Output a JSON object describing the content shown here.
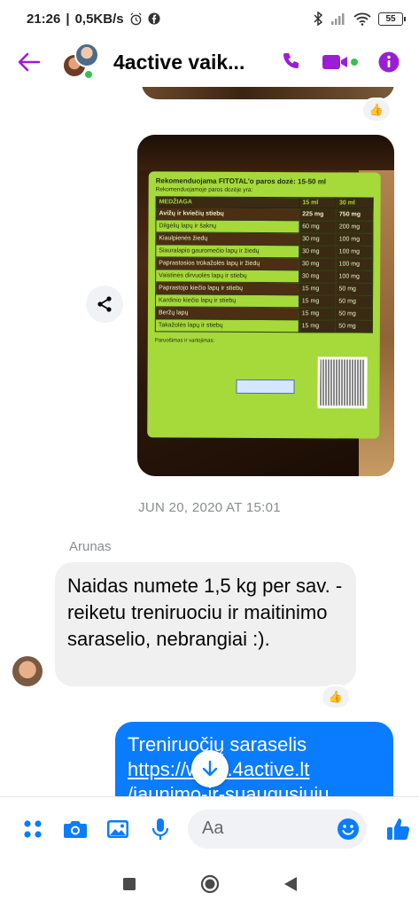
{
  "status_bar": {
    "time": "21:26",
    "speed": "0,5KB/s",
    "battery": "55",
    "icons": [
      "alarm-icon",
      "facebook-icon",
      "bluetooth-icon",
      "signal-icon",
      "wifi-icon",
      "battery-icon"
    ]
  },
  "header": {
    "title": "4active vaik...",
    "back_icon": "arrow-left-icon",
    "actions": [
      "phone-icon",
      "video-icon",
      "info-icon"
    ],
    "accent_color": "#9b1ed6"
  },
  "photo_label": {
    "title": "Rekomenduojama FITOTAL'o paros dozė: 15-50 ml",
    "subtitle": "Rekomenduojamoje paros dozėje yra:",
    "columns": [
      "MEDŽIAGA",
      "15 ml",
      "30 ml"
    ],
    "rows": [
      [
        "Avižų ir kviečių stiebų",
        "225 mg",
        "750 mg"
      ],
      [
        "Dilgėlių lapų ir šaknų",
        "60 mg",
        "200 mg"
      ],
      [
        "Kiaulpienės žiedų",
        "30 mg",
        "100 mg"
      ],
      [
        "Siauralapio gauromečio lapų ir žiedų",
        "30 mg",
        "100 mg"
      ],
      [
        "Paprastosios trūkažolės lapų ir žiedų",
        "30 mg",
        "100 mg"
      ],
      [
        "Vaistinės dirvuolės lapų ir stiebų",
        "30 mg",
        "100 mg"
      ],
      [
        "Paprastojo kiečio lapų ir stiebų",
        "15 mg",
        "50 mg"
      ],
      [
        "Kardinio kiečio lapų ir stiebų",
        "15 mg",
        "50 mg"
      ],
      [
        "Beržų lapų",
        "15 mg",
        "50 mg"
      ],
      [
        "Takažolės lapų ir stiebų",
        "15 mg",
        "50 mg"
      ]
    ],
    "usage_title": "Paruošimas ir vartojimas:"
  },
  "conversation": {
    "timestamp": "JUN 20, 2020 AT 15:01",
    "sender": "Arunas",
    "incoming_text": "Naidas numete 1,5 kg per sav. - reiketu treniruociu ir maitinimo saraselio, nebrangiai :).",
    "outgoing_line1": "Treniruočių saraselis",
    "outgoing_link": "https://www.4active.lt",
    "outgoing_line3": "/jaunimo-ir-suaugusiuju",
    "outgoing_color": "#0a7cff"
  },
  "composer": {
    "placeholder": "Aa",
    "icons": [
      "grid-menu-icon",
      "camera-icon",
      "image-icon",
      "microphone-icon",
      "emoji-icon",
      "thumbs-up-icon"
    ],
    "icon_color": "#0a7cff"
  },
  "nav": {
    "icons": [
      "square-icon",
      "circle-icon",
      "triangle-back-icon"
    ]
  }
}
